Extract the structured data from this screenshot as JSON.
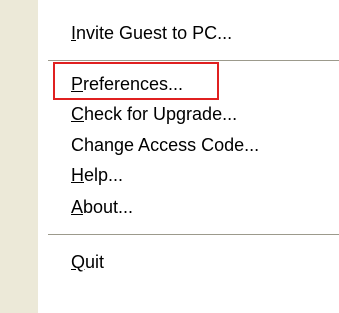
{
  "menu": {
    "items": [
      {
        "mnemonic": "I",
        "rest": "nvite Guest to PC..."
      },
      {
        "mnemonic": "P",
        "rest": "references..."
      },
      {
        "mnemonic": "C",
        "rest": "heck for Upgrade..."
      },
      {
        "mnemonic": "",
        "rest": "Change Access Code..."
      },
      {
        "mnemonic": "H",
        "rest": "elp..."
      },
      {
        "mnemonic": "A",
        "rest": "bout..."
      },
      {
        "mnemonic": "Q",
        "rest": "uit"
      }
    ]
  },
  "colors": {
    "gutter": "#ece9d8",
    "separator": "#9c9a8c",
    "highlight_box": "#e02020"
  }
}
